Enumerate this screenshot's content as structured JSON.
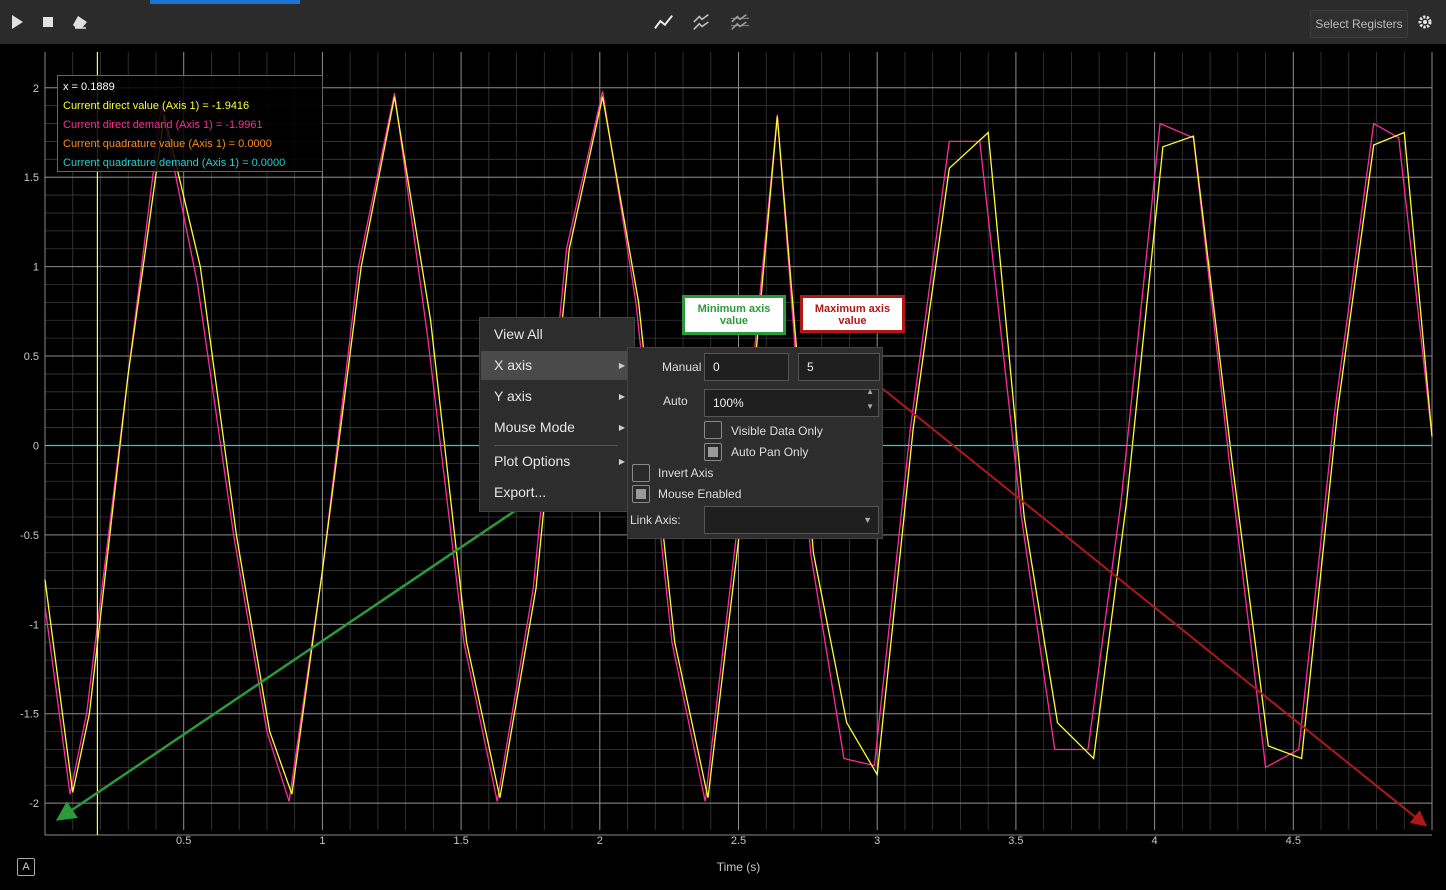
{
  "toolbar": {
    "play_icon": "play-icon",
    "stop_icon": "stop-icon",
    "erase_icon": "eraser-icon",
    "select_registers_label": "Select Registers",
    "settings_icon": "gear-icon"
  },
  "legend": {
    "x_readout": "x = 0.1889",
    "lines": [
      {
        "text": "Current direct value (Axis 1) = -1.9416",
        "color": "#ffff33"
      },
      {
        "text": "Current direct demand (Axis 1) = -1.9961",
        "color": "#ff2a9a"
      },
      {
        "text": "Current quadrature value (Axis 1) = 0.0000",
        "color": "#ff8c1a"
      },
      {
        "text": "Current quadrature demand (Axis 1) = 0.0000",
        "color": "#22d0d0"
      }
    ]
  },
  "context_menu": {
    "items": [
      "View All",
      "X axis",
      "Y axis",
      "Mouse Mode",
      "Plot Options",
      "Export..."
    ]
  },
  "x_axis_submenu": {
    "manual_label": "Manual",
    "manual_min": "0",
    "manual_max": "5",
    "auto_label": "Auto",
    "auto_value": "100%",
    "visible_data_only": "Visible Data Only",
    "auto_pan_only": "Auto Pan Only",
    "invert_axis": "Invert Axis",
    "mouse_enabled": "Mouse Enabled",
    "link_axis": "Link Axis:"
  },
  "callouts": {
    "min_label": "Minimum axis value",
    "max_label": "Maximum axis value",
    "min_color": "#2a9a3a",
    "max_color": "#b01818"
  },
  "corner_button": "A",
  "chart_data": {
    "type": "line",
    "xlabel": "Time (s)",
    "ylabel": "",
    "xlim": [
      0,
      5
    ],
    "ylim": [
      -2.15,
      2.2
    ],
    "x_ticks": [
      0.5,
      1,
      1.5,
      2,
      2.5,
      3,
      3.5,
      4,
      4.5
    ],
    "y_ticks": [
      2,
      1.5,
      1,
      0.5,
      0,
      -0.5,
      -1,
      -1.5,
      -2
    ],
    "cursor_x": 0.1889,
    "grid": true,
    "series": [
      {
        "name": "Current direct demand (Axis 1)",
        "color": "#ff2a9a",
        "x": [
          0.0,
          0.09,
          0.15,
          0.3,
          0.42,
          0.55,
          0.68,
          0.8,
          0.88,
          1.0,
          1.13,
          1.26,
          1.38,
          1.51,
          1.63,
          1.76,
          1.88,
          2.01,
          2.13,
          2.26,
          2.38,
          2.5,
          2.64,
          2.76,
          2.88,
          2.99,
          3.12,
          3.26,
          3.37,
          3.52,
          3.64,
          3.76,
          3.88,
          4.02,
          4.14,
          4.27,
          4.4,
          4.52,
          4.65,
          4.79,
          4.88,
          5.0
        ],
        "y": [
          -0.9,
          -1.95,
          -1.5,
          0.4,
          1.9,
          0.9,
          -0.5,
          -1.6,
          -1.99,
          -0.7,
          1.0,
          1.97,
          0.6,
          -1.1,
          -1.99,
          -0.8,
          1.1,
          1.98,
          0.8,
          -1.1,
          -1.99,
          -0.4,
          1.85,
          -0.6,
          -1.75,
          -1.79,
          0.1,
          1.7,
          1.7,
          -0.4,
          -1.7,
          -1.7,
          -0.3,
          1.8,
          1.72,
          -0.1,
          -1.8,
          -1.7,
          0.2,
          1.8,
          1.72,
          0.05
        ],
        "note_hidden": ""
      },
      {
        "name": "Current direct value (Axis 1)",
        "color": "#ffff33",
        "x": [
          0.0,
          0.1,
          0.16,
          0.3,
          0.43,
          0.56,
          0.69,
          0.81,
          0.89,
          1.0,
          1.14,
          1.26,
          1.39,
          1.52,
          1.64,
          1.77,
          1.89,
          2.01,
          2.14,
          2.27,
          2.39,
          2.51,
          2.64,
          2.77,
          2.89,
          3.0,
          3.13,
          3.26,
          3.4,
          3.53,
          3.65,
          3.78,
          3.9,
          4.03,
          4.14,
          4.28,
          4.41,
          4.53,
          4.66,
          4.79,
          4.9,
          5.0
        ],
        "y": [
          -0.75,
          -1.94,
          -1.5,
          0.4,
          1.85,
          1.0,
          -0.5,
          -1.6,
          -1.95,
          -0.7,
          1.0,
          1.95,
          0.7,
          -1.1,
          -1.97,
          -0.8,
          1.1,
          1.95,
          0.8,
          -1.1,
          -1.97,
          -0.4,
          1.84,
          -0.6,
          -1.55,
          -1.84,
          0.1,
          1.55,
          1.75,
          -0.4,
          -1.55,
          -1.75,
          -0.3,
          1.67,
          1.73,
          -0.1,
          -1.68,
          -1.75,
          0.2,
          1.68,
          1.75,
          0.05
        ]
      },
      {
        "name": "Current quadrature demand (Axis 1)",
        "color": "#22d0d0",
        "x": [
          0,
          5
        ],
        "y": [
          0,
          0
        ]
      }
    ]
  }
}
